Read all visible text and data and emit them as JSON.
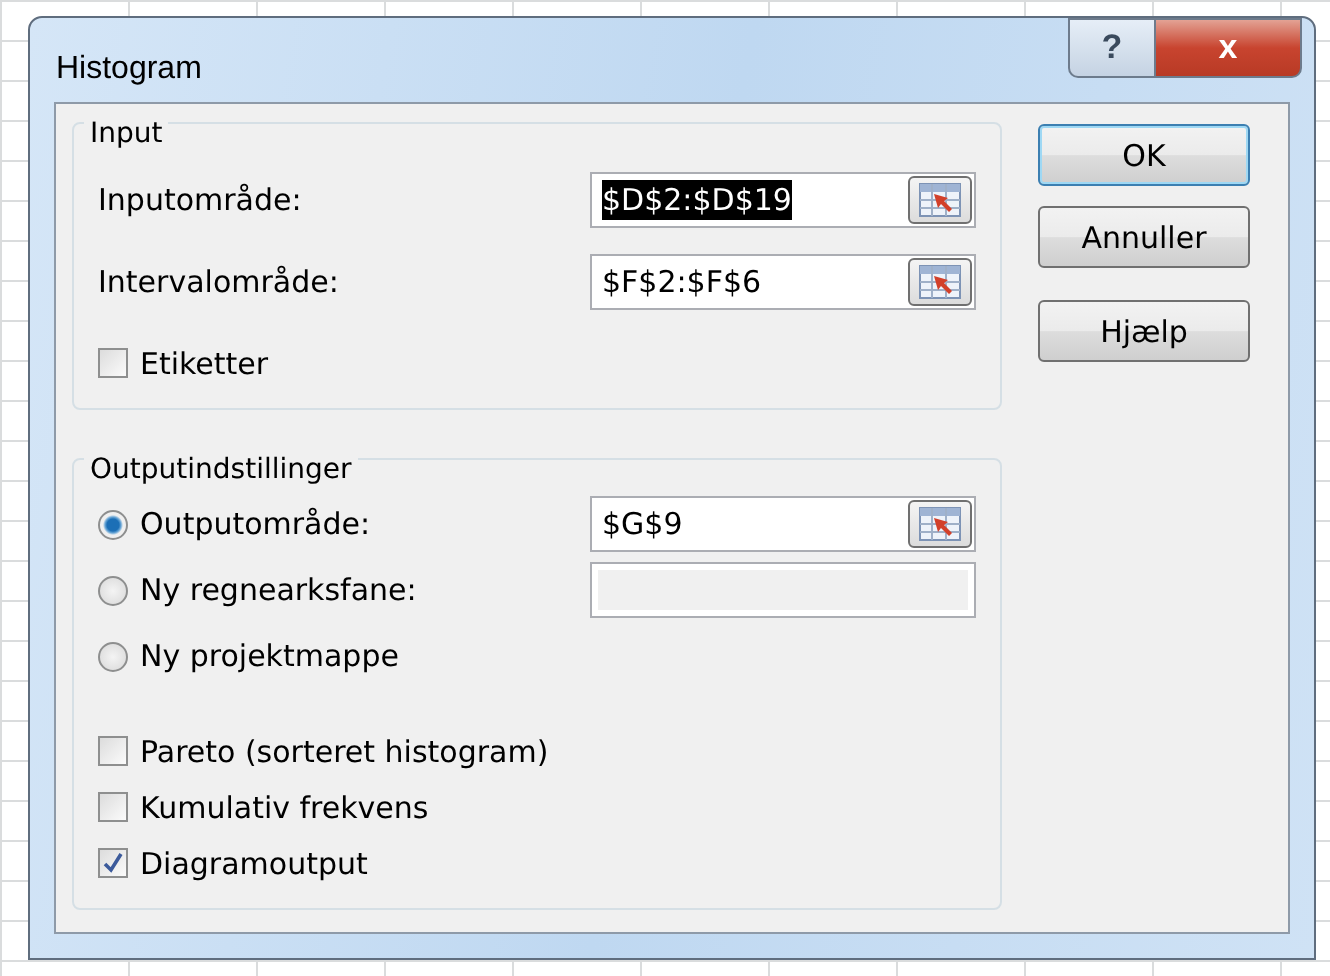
{
  "window": {
    "title": "Histogram",
    "help_button": "?",
    "close_button": "x"
  },
  "input_group": {
    "title": "Input",
    "fields": [
      {
        "label": "Inputområde:",
        "value": "$D$2:$D$19",
        "selected": true
      },
      {
        "label": "Intervalområde:",
        "value": "$F$2:$F$6",
        "selected": false
      }
    ],
    "checkboxes": [
      {
        "label": "Etiketter",
        "checked": false
      }
    ]
  },
  "output_group": {
    "title": "Outputindstillinger",
    "options": [
      {
        "label": "Outputområde:",
        "selected": true,
        "field": {
          "value": "$G$9",
          "disabled": false
        }
      },
      {
        "label": "Ny regnearksfane:",
        "selected": false,
        "field": {
          "disabled": true
        }
      },
      {
        "label": "Ny projektmappe",
        "selected": false
      }
    ],
    "checkboxes": [
      {
        "label": "Pareto (sorteret histogram)",
        "checked": false
      },
      {
        "label": "Kumulativ frekvens",
        "checked": false
      },
      {
        "label": "Diagramoutput",
        "checked": true
      }
    ]
  },
  "buttons": [
    {
      "label": "OK",
      "default": true
    },
    {
      "label": "Annuller",
      "default": false
    },
    {
      "label": "Hjælp",
      "default": false
    }
  ]
}
